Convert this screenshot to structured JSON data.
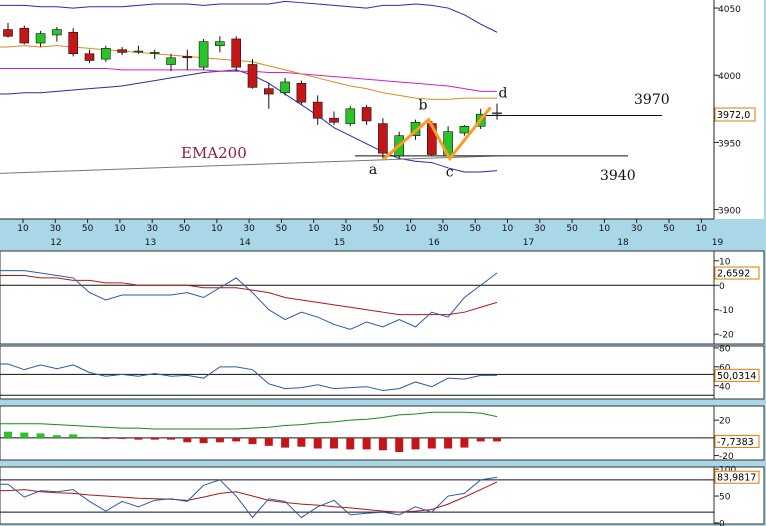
{
  "chart_data": [
    {
      "type": "candlestick",
      "price_axis": {
        "ticks": [
          4050,
          4000,
          3950,
          3900
        ],
        "range": [
          3893,
          4056
        ]
      },
      "time_axis": {
        "minute_ticks": [
          "10",
          "30",
          "50",
          "10",
          "30",
          "50",
          "10",
          "30",
          "50",
          "10",
          "30",
          "50",
          "10",
          "30",
          "50",
          "10",
          "30",
          "50",
          "10",
          "30",
          "50",
          "10"
        ],
        "day_labels": [
          "12",
          "13",
          "14",
          "15",
          "16",
          "17",
          "18",
          "19"
        ]
      },
      "candles": [
        {
          "o": 4034,
          "h": 4039,
          "l": 4028,
          "c": 4029
        },
        {
          "o": 4035,
          "h": 4037,
          "l": 4023,
          "c": 4024
        },
        {
          "o": 4024,
          "h": 4033,
          "l": 4021,
          "c": 4031
        },
        {
          "o": 4030,
          "h": 4036,
          "l": 4025,
          "c": 4034
        },
        {
          "o": 4032,
          "h": 4035,
          "l": 4014,
          "c": 4016
        },
        {
          "o": 4016,
          "h": 4019,
          "l": 4009,
          "c": 4011
        },
        {
          "o": 4012,
          "h": 4022,
          "l": 4010,
          "c": 4020
        },
        {
          "o": 4019,
          "h": 4021,
          "l": 4015,
          "c": 4017
        },
        {
          "o": 4018,
          "h": 4022,
          "l": 4016,
          "c": 4018
        },
        {
          "o": 4017,
          "h": 4019,
          "l": 4012,
          "c": 4017
        },
        {
          "o": 4008,
          "h": 4016,
          "l": 4003,
          "c": 4013
        },
        {
          "o": 4014,
          "h": 4019,
          "l": 4004,
          "c": 4013
        },
        {
          "o": 4006,
          "h": 4027,
          "l": 4004,
          "c": 4025
        },
        {
          "o": 4022,
          "h": 4029,
          "l": 4017,
          "c": 4025
        },
        {
          "o": 4027,
          "h": 4029,
          "l": 4003,
          "c": 4006
        },
        {
          "o": 4008,
          "h": 4012,
          "l": 3990,
          "c": 3991
        },
        {
          "o": 3990,
          "h": 3994,
          "l": 3975,
          "c": 3986
        },
        {
          "o": 3987,
          "h": 3998,
          "l": 3985,
          "c": 3995
        },
        {
          "o": 3994,
          "h": 3996,
          "l": 3978,
          "c": 3980
        },
        {
          "o": 3980,
          "h": 3985,
          "l": 3963,
          "c": 3968
        },
        {
          "o": 3968,
          "h": 3973,
          "l": 3963,
          "c": 3965
        },
        {
          "o": 3964,
          "h": 3977,
          "l": 3962,
          "c": 3975
        },
        {
          "o": 3976,
          "h": 3978,
          "l": 3963,
          "c": 3966
        },
        {
          "o": 3964,
          "h": 3968,
          "l": 3938,
          "c": 3942
        },
        {
          "o": 3940,
          "h": 3958,
          "l": 3938,
          "c": 3955
        },
        {
          "o": 3955,
          "h": 3967,
          "l": 3952,
          "c": 3965
        },
        {
          "o": 3964,
          "h": 3966,
          "l": 3940,
          "c": 3941
        },
        {
          "o": 3940,
          "h": 3962,
          "l": 3939,
          "c": 3958
        },
        {
          "o": 3957,
          "h": 3963,
          "l": 3955,
          "c": 3962
        },
        {
          "o": 3962,
          "h": 3975,
          "l": 3960,
          "c": 3971
        },
        {
          "o": 3972,
          "h": 3979,
          "l": 3967,
          "c": 3972
        }
      ],
      "upper_band": [
        4052,
        4052,
        4051,
        4051,
        4050,
        4051,
        4051,
        4051,
        4052,
        4053,
        4053,
        4053,
        4052,
        4053,
        4053,
        4053,
        4053,
        4055,
        4054,
        4053,
        4052,
        4051,
        4050,
        4052,
        4052,
        4053,
        4052,
        4050,
        4045,
        4038,
        4032
      ],
      "lower_band": [
        3986,
        3987,
        3987,
        3988,
        3989,
        3990,
        3991,
        3992,
        3994,
        3996,
        3998,
        4000,
        4002,
        4003,
        4004,
        4000,
        3994,
        3986,
        3978,
        3970,
        3961,
        3955,
        3949,
        3943,
        3938,
        3936,
        3935,
        3931,
        3928,
        3928,
        3929
      ],
      "ma_orange": [
        4021,
        4022,
        4021,
        4022,
        4021,
        4020,
        4019,
        4018,
        4017,
        4016,
        4015,
        4014,
        4013,
        4012,
        4011,
        4010,
        4007,
        4004,
        4001,
        3998,
        3995,
        3992,
        3990,
        3987,
        3985,
        3983,
        3982,
        3982,
        3983,
        3983,
        3983
      ],
      "ma_magenta": [
        4005,
        4005,
        4005,
        4005,
        4005,
        4005,
        4005,
        4004,
        4004,
        4004,
        4004,
        4004,
        4004,
        4003,
        4003,
        4003,
        4002,
        4002,
        4001,
        4000,
        3999,
        3998,
        3997,
        3996,
        3995,
        3994,
        3993,
        3992,
        3990,
        3988,
        3988
      ],
      "ema200": {
        "label": "EMA200",
        "from": 3927,
        "to": 3940
      },
      "pattern": {
        "points": [
          {
            "label": "a",
            "idx": 23,
            "price": 3937
          },
          {
            "label": "b",
            "idx": 25.8,
            "price": 3967
          },
          {
            "label": "c",
            "idx": 27.1,
            "price": 3938
          },
          {
            "label": "d",
            "idx": 29.6,
            "price": 3976
          }
        ],
        "color": "#ff9a26"
      },
      "levels": [
        {
          "label": "3970",
          "price": 3970
        },
        {
          "label": "3940",
          "price": 3940
        }
      ],
      "current_value": "3972,0"
    },
    {
      "type": "line",
      "ticks": [
        "10",
        "0",
        "-10",
        "-20"
      ],
      "range": [
        -24,
        14
      ],
      "reference_line": 0,
      "main": [
        6,
        6,
        5,
        4,
        3,
        -3,
        -6,
        -4,
        -4,
        -4,
        -4,
        -3,
        -5,
        -1,
        3,
        -3,
        -10,
        -14,
        -11,
        -13,
        -16,
        -18,
        -15,
        -17,
        -14,
        -17,
        -11,
        -13,
        -5,
        0,
        5
      ],
      "signal": [
        4,
        4,
        3,
        3,
        2,
        2,
        1,
        1,
        0,
        0,
        0,
        0,
        -1,
        -1,
        -1,
        -2,
        -3,
        -5,
        -6,
        -7,
        -8,
        -9,
        -10,
        -11,
        -12,
        -12,
        -12,
        -12,
        -11,
        -9,
        -7
      ],
      "current_value": "2,6592"
    },
    {
      "type": "line",
      "ticks": [
        "80",
        "60",
        "40"
      ],
      "range": [
        26,
        82
      ],
      "reference_lines": [
        52,
        30
      ],
      "main": [
        63,
        57,
        62,
        58,
        62,
        54,
        50,
        52,
        50,
        53,
        50,
        51,
        48,
        60,
        60,
        57,
        42,
        37,
        38,
        41,
        37,
        38,
        39,
        35,
        37,
        44,
        39,
        48,
        47,
        51,
        51
      ],
      "current_value": "50,0314"
    },
    {
      "type": "bar",
      "ticks": [
        "20",
        "0",
        "-20"
      ],
      "range": [
        -25,
        36
      ],
      "reference_line": 0,
      "bars": [
        7,
        6,
        5,
        3,
        4,
        1,
        -1,
        -1,
        -2,
        -2,
        -2,
        -5,
        -6,
        -5,
        -4,
        -7,
        -9,
        -11,
        -10,
        -12,
        -12,
        -13,
        -13,
        -14,
        -16,
        -13,
        -12,
        -12,
        -11,
        -4,
        -4
      ],
      "signal": [
        16,
        16,
        16,
        15,
        14,
        13,
        12,
        11,
        11,
        10,
        10,
        10,
        10,
        10,
        10,
        11,
        12,
        14,
        15,
        17,
        18,
        20,
        21,
        23,
        26,
        27,
        29,
        29,
        29,
        28,
        24
      ],
      "current_value": "-7,7383"
    },
    {
      "type": "line",
      "ticks": [
        "100",
        "50",
        "0"
      ],
      "range": [
        -2,
        104
      ],
      "reference_lines": [
        80,
        20
      ],
      "main": [
        72,
        48,
        60,
        58,
        62,
        40,
        22,
        40,
        30,
        42,
        45,
        40,
        70,
        80,
        50,
        10,
        45,
        40,
        10,
        30,
        42,
        15,
        18,
        20,
        15,
        30,
        20,
        50,
        55,
        80,
        85
      ],
      "signal": [
        60,
        62,
        58,
        56,
        55,
        52,
        50,
        48,
        46,
        45,
        44,
        42,
        48,
        55,
        58,
        50,
        42,
        38,
        35,
        33,
        30,
        28,
        25,
        22,
        20,
        22,
        25,
        35,
        48,
        62,
        76
      ],
      "current_value": "83,9817"
    }
  ]
}
